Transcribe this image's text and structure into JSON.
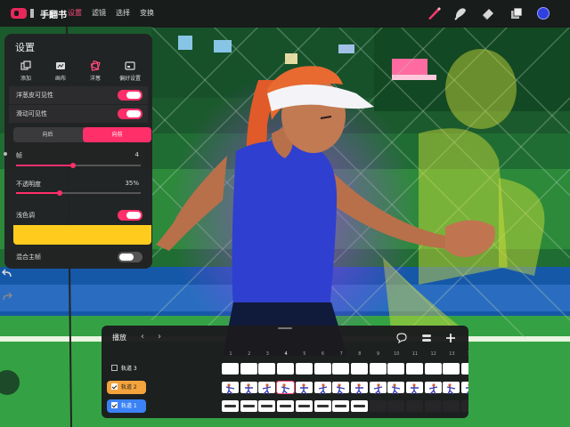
{
  "app": {
    "title": "手翻书",
    "menus": [
      "设置",
      "滤镜",
      "选择",
      "变换"
    ],
    "active_menu": "设置",
    "tools": [
      "brush-icon",
      "smudge-icon",
      "eraser-icon",
      "layers-icon"
    ],
    "current_color": "#2f3fe0",
    "accent": "#ff2f6a"
  },
  "settings": {
    "title": "设置",
    "tabs": [
      {
        "label": "添加",
        "icon": "add-icon"
      },
      {
        "label": "画布",
        "icon": "canvas-icon"
      },
      {
        "label": "洋葱",
        "icon": "onion-icon"
      },
      {
        "label": "偏好设置",
        "icon": "preferences-icon"
      }
    ],
    "onion_visible_label": "洋葱皮可见性",
    "onion_visible": true,
    "scrub_visible_label": "滑动可见性",
    "scrub_visible": true,
    "direction_back": "向后",
    "direction_front": "向前",
    "direction_selected": "向前",
    "frames_label": "帧",
    "frames_value": "4",
    "frames_fraction": 0.46,
    "opacity_label": "不透明度",
    "opacity_value": "35%",
    "opacity_fraction": 0.35,
    "tint_label": "浅色调",
    "tint_enabled": true,
    "tint_color": "#ffcc1e",
    "blend_label": "混合主帧",
    "blend_enabled": false
  },
  "timeline": {
    "play_label": "播放",
    "frame_numbers": [
      "1",
      "2",
      "3",
      "4",
      "5",
      "6",
      "7",
      "8",
      "9",
      "10",
      "11",
      "12",
      "13",
      "14"
    ],
    "current_frame": "4",
    "tracks": [
      {
        "label": "轨道 3",
        "checked": false,
        "color": "transparent"
      },
      {
        "label": "轨道 2",
        "checked": true,
        "color": "#f5a33c"
      },
      {
        "label": "轨道 1",
        "checked": true,
        "color": "#3b82f6"
      }
    ]
  }
}
